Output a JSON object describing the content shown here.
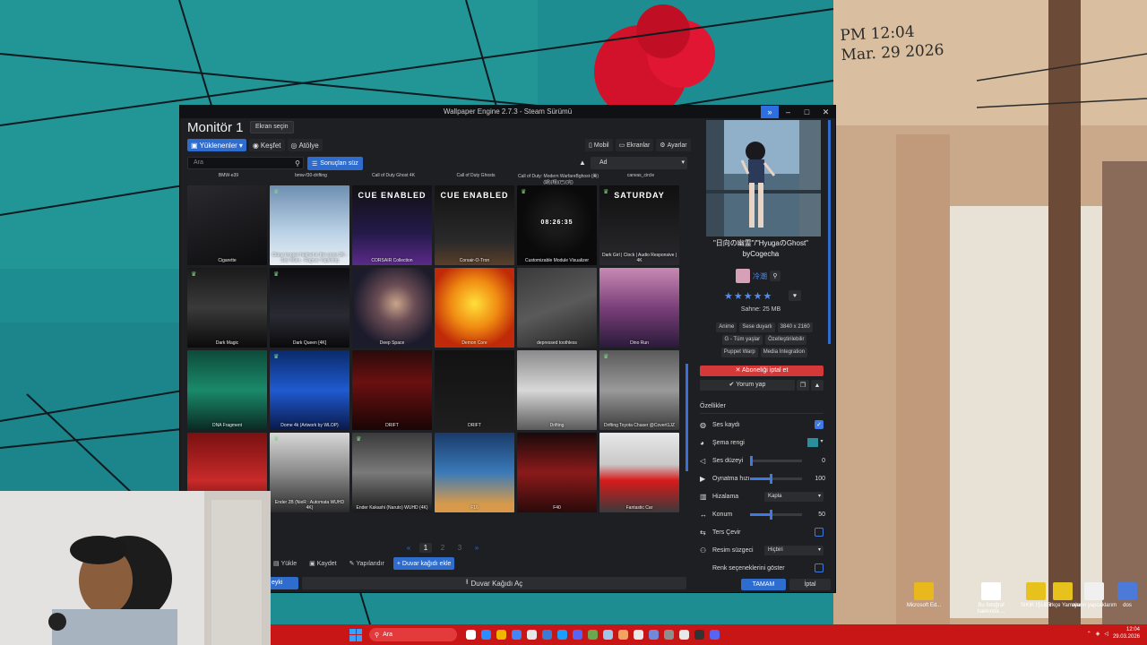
{
  "desktop": {
    "note_line1": "PM 12:04",
    "note_line2": "Mar. 29 2026",
    "icons": [
      {
        "label": "Microsoft Ed...",
        "color": "#e8b81c"
      },
      {
        "label": "Bu fotoğraf hakkında ...",
        "color": "#ffffff"
      },
      {
        "label": "SIKIK İŞLER",
        "color": "#e8c21c"
      },
      {
        "label": "Türkçe Yamalar",
        "color": "#e8c21c"
      },
      {
        "label": "oyunn yapcaklarım",
        "color": "#f0f0f0"
      },
      {
        "label": "dos",
        "color": "#4b7ad8"
      }
    ]
  },
  "window": {
    "title": "Wallpaper Engine 2.7.3 - Steam Sürümü",
    "monitor_title": "Monitör 1",
    "select_screen": "Ekran seçin",
    "tabs": [
      {
        "label": "Yüklenenler",
        "icon": "save-icon",
        "active": true
      },
      {
        "label": "Keşfet",
        "icon": "compass-icon",
        "active": false
      },
      {
        "label": "Atölye",
        "icon": "steam-icon",
        "active": false
      }
    ],
    "right_nav": [
      {
        "label": "Mobil",
        "icon": "mobile-icon"
      },
      {
        "label": "Ekranlar",
        "icon": "monitor-icon"
      },
      {
        "label": "Ayarlar",
        "icon": "gear-icon"
      }
    ],
    "search_placeholder": "Ara",
    "filter_label": "Sonuçları süz",
    "sort_value": "Ad",
    "top_labels": [
      "BMW-e39",
      "bmw-f30-drifting",
      "Call of Duty Ghost 4K",
      "Call of Duty Ghosts",
      "Call of Duty: Modern WarfareBghost-(美)(期)(翔)(已)(完)",
      "canvas_circle"
    ],
    "tiles": [
      {
        "label": "Cigarette",
        "bg": "linear-gradient(160deg,#2a2a2e,#0d0d0f)",
        "trophy": false
      },
      {
        "label": "Clone trooper helmet in the snow 2K - Star Wars - Ragnar Vapleting",
        "bg": "linear-gradient(180deg,#6e8fb2,#bcd3e6 60%,#e8eef4)",
        "trophy": true
      },
      {
        "label": "CORSAIR Collection",
        "bg": "linear-gradient(180deg,#111 0%,#241a4a 60%,#5b2a8a)",
        "trophy": false,
        "text": "CUE ENABLED"
      },
      {
        "label": "Corsair-O-Tron",
        "bg": "linear-gradient(180deg,#121212,#2a2a2a 70%,#5a3f2a)",
        "trophy": false,
        "text": "CUE ENABLED"
      },
      {
        "label": "Customizable Module Visualizer",
        "bg": "radial-gradient(circle at 50% 45%,#1a1a1a 20%,#0a0a0a 60%)",
        "trophy": true,
        "text": "08:26:35"
      },
      {
        "label": "Dark Girl | Clock | Audio Responsive | 4K",
        "bg": "linear-gradient(180deg,#101010,#2a2a2e)",
        "trophy": true,
        "text": "SATURDAY"
      },
      {
        "label": "Dark Magic",
        "bg": "linear-gradient(180deg,#1a1a1a,#3a3a3a 50%,#0b0b0b)",
        "trophy": true
      },
      {
        "label": "Dark Queen [4K]",
        "bg": "linear-gradient(180deg,#0d0d10,#2a2a34 60%,#0a0a0c)",
        "trophy": true
      },
      {
        "label": "Deep Space",
        "bg": "radial-gradient(circle at 55% 45%,#c9a58a 0%,#6b4d55 30%,#1c1b2c 70%)",
        "trophy": false
      },
      {
        "label": "Demon Core",
        "bg": "radial-gradient(circle at 50% 45%,#ffe03a 0%,#f08b12 40%,#c02a08 75%)",
        "trophy": false
      },
      {
        "label": "depressed toothless",
        "bg": "linear-gradient(160deg,#3a3a3a,#5a5a5a 50%,#222)",
        "trophy": false
      },
      {
        "label": "Dino Run",
        "bg": "linear-gradient(180deg,#c88ab2 0%,#7a3f7a 50%,#2a1a3a)",
        "trophy": false
      },
      {
        "label": "DNA Fragment",
        "bg": "linear-gradient(180deg,#0d4a3a,#1a8a6a 50%,#0a2a22)",
        "trophy": false
      },
      {
        "label": "Dome 4k (Artwork by WLOP)",
        "bg": "linear-gradient(180deg,#0a2a6a,#1f5ad0 50%,#0a1a4a)",
        "trophy": true
      },
      {
        "label": "DRIFT",
        "bg": "linear-gradient(180deg,#2a0a0a,#6a1010 40%,#1a0505)",
        "trophy": false
      },
      {
        "label": "DRIFT",
        "bg": "linear-gradient(180deg,#121212,#1e1e1e)",
        "trophy": false
      },
      {
        "label": "Drifting",
        "bg": "linear-gradient(180deg,#8a8a8a,#d8d8d8 50%,#5a5a5a)",
        "trophy": false
      },
      {
        "label": "Drifting Toyota Chaser @Covert1JZ",
        "bg": "linear-gradient(180deg,#5a5a5a,#9a9a9a 50%,#3a3a3a)",
        "trophy": true
      },
      {
        "label": "",
        "bg": "linear-gradient(180deg,#7a1010,#c82a2a 60%,#5a0a0a)",
        "trophy": false
      },
      {
        "label": "Ender 2B (NieR : Automata WUHD 4K)",
        "bg": "linear-gradient(180deg,#d8d8d8,#8a8a8a 50%,#2a2a2a)",
        "trophy": true
      },
      {
        "label": "Ender Kakashi (Naruto) WUHD (4K)",
        "bg": "linear-gradient(180deg,#3a3a3a,#7a7a7a 50%,#1a1a1a)",
        "trophy": true
      },
      {
        "label": "F16",
        "bg": "linear-gradient(180deg,#1a3a6a,#3a7ab8 50%,#d89a4a 90%)",
        "trophy": false
      },
      {
        "label": "F40",
        "bg": "linear-gradient(180deg,#1a0a0a,#8a1a1a 50%,#2a0a0a)",
        "trophy": false
      },
      {
        "label": "Fantastic Car",
        "bg": "linear-gradient(180deg,#e8e8e8,#c8c8c8 40%,#d81a1a 60%,#3a3a3a)",
        "trophy": false
      }
    ],
    "pager": {
      "current": "1",
      "pages": [
        "2",
        "3"
      ]
    },
    "bottom_buttons": [
      {
        "label": "Yükle",
        "icon": "folder-icon",
        "blue": false
      },
      {
        "label": "Kaydet",
        "icon": "save-icon",
        "blue": false
      },
      {
        "label": "Yapılandır",
        "icon": "settings-icon",
        "blue": false
      },
      {
        "label": "Duvar kağıdı ekle",
        "icon": "plus-icon",
        "blue": true
      }
    ],
    "footer_left": "eyki",
    "open_wallpaper": "Duvar Kağıdı Aç",
    "panel": {
      "title": "\"日向の幽霊\"/\"HyugaのGhost\"",
      "by": "byCogecha",
      "author": "冷潮",
      "rating": "★★★★★",
      "scene_size": "Sahne: 25 MB",
      "tags": [
        "Anime",
        "Sese duyarlı",
        "3840 x 2160",
        "G - Tüm yaşlar",
        "Özelleştirilebilir",
        "Puppet Warp",
        "Media Integration"
      ],
      "unsubscribe": "✕ Aboneliği iptal et",
      "comment": "Yorum yap",
      "props_title": "Özellikler",
      "props": [
        {
          "label": "Ses kaydı",
          "icon": "mic-icon",
          "kind": "check",
          "on": true
        },
        {
          "label": "Şema rengi",
          "icon": "palette-icon",
          "kind": "color"
        },
        {
          "label": "Ses düzeyi",
          "icon": "volume-icon",
          "kind": "slider",
          "value": "0",
          "pct": 0
        },
        {
          "label": "Oynatma hızı",
          "icon": "play-icon",
          "kind": "slider",
          "value": "100",
          "pct": 0.4
        },
        {
          "label": "Hizalama",
          "icon": "align-icon",
          "kind": "select",
          "value": "Kapla"
        },
        {
          "label": "Konum",
          "icon": "move-icon",
          "kind": "slider",
          "value": "50",
          "pct": 0.4
        },
        {
          "label": "Ters Çevir",
          "icon": "flip-icon",
          "kind": "check",
          "on": false
        },
        {
          "label": "Resim süzgeci",
          "icon": "filter-icon",
          "kind": "select",
          "value": "Hiçbiri"
        },
        {
          "label": "Renk seçeneklerini göster",
          "icon": "",
          "kind": "check",
          "on": false
        }
      ],
      "ok": "TAMAM",
      "cancel": "İptal"
    }
  },
  "taskbar": {
    "search_placeholder": "Ara",
    "time": "12:04",
    "date": "29.03.2026",
    "app_colors": [
      "#ffffff",
      "#2d8cff",
      "#f4b400",
      "#4285f4",
      "#e8e8e8",
      "#3a7bd5",
      "#1a9fff",
      "#5865f2",
      "#6aa84f",
      "#9fc5e8",
      "#f4a261",
      "#e8e8e8",
      "#7289da",
      "#8e8e8e",
      "#e8e8e8",
      "#333333",
      "#5865f2"
    ]
  }
}
